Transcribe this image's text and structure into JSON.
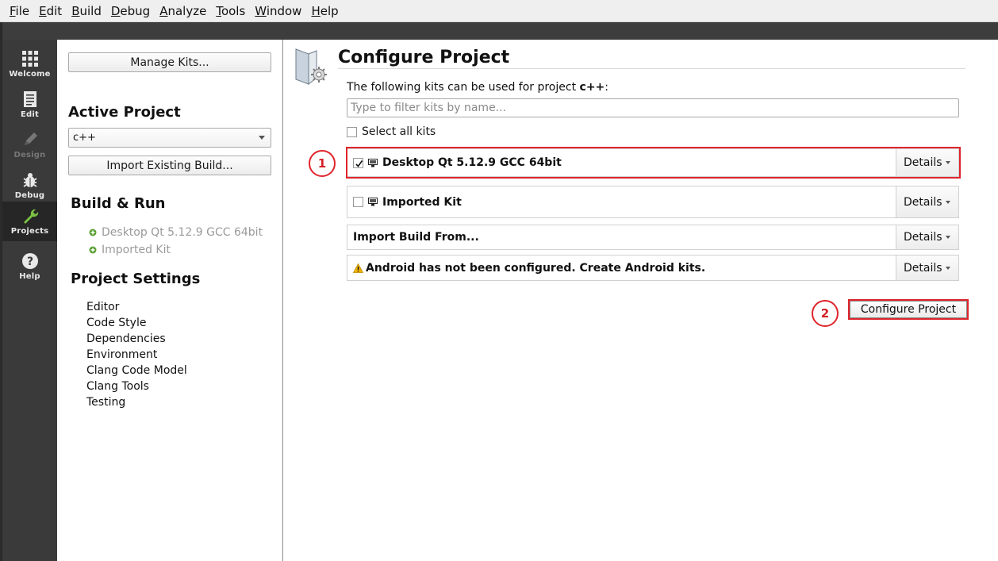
{
  "menubar": {
    "items": [
      {
        "label": "File",
        "u": "F",
        "rest": "ile"
      },
      {
        "label": "Edit",
        "u": "E",
        "rest": "dit"
      },
      {
        "label": "Build",
        "u": "B",
        "rest": "uild"
      },
      {
        "label": "Debug",
        "u": "D",
        "rest": "ebug"
      },
      {
        "label": "Analyze",
        "u": "A",
        "rest": "nalyze"
      },
      {
        "label": "Tools",
        "u": "T",
        "rest": "ools"
      },
      {
        "label": "Window",
        "u": "W",
        "rest": "indow"
      },
      {
        "label": "Help",
        "u": "H",
        "rest": "elp"
      }
    ]
  },
  "modes": {
    "welcome": "Welcome",
    "edit": "Edit",
    "design": "Design",
    "debug": "Debug",
    "projects": "Projects",
    "help": "Help"
  },
  "sidebar": {
    "manage_kits": "Manage Kits...",
    "active_project_heading": "Active Project",
    "active_project_value": "c++",
    "import_existing_build": "Import Existing Build...",
    "build_run_heading": "Build & Run",
    "kits": [
      "Desktop Qt 5.12.9 GCC 64bit",
      "Imported Kit"
    ],
    "project_settings_heading": "Project Settings",
    "settings_items": [
      "Editor",
      "Code Style",
      "Dependencies",
      "Environment",
      "Clang Code Model",
      "Clang Tools",
      "Testing"
    ]
  },
  "main": {
    "title": "Configure Project",
    "description_prefix": "The following kits can be used for project ",
    "project_name": "c++",
    "description_suffix": ":",
    "filter_placeholder": "Type to filter kits by name...",
    "select_all_label": "Select all kits",
    "kit_rows": [
      {
        "label": "Desktop Qt 5.12.9 GCC 64bit",
        "checked": true,
        "details": "Details"
      },
      {
        "label": "Imported Kit",
        "checked": false,
        "details": "Details"
      },
      {
        "label": "Import Build From...",
        "details": "Details"
      },
      {
        "label": "Android has not been configured. Create Android kits.",
        "details": "Details"
      }
    ],
    "configure_button": "Configure Project"
  },
  "annotations": {
    "callout_1": "1",
    "callout_2": "2",
    "color": "#e0242c"
  },
  "colors": {
    "modebar": "#3a3a3a",
    "active_mode": "#262626",
    "kit_bullet": "#5aa033",
    "warning": "#f0b400"
  }
}
